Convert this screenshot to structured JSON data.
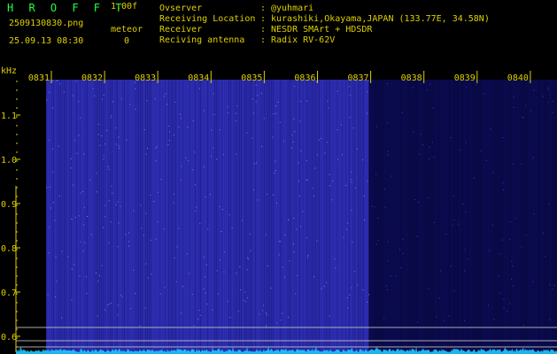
{
  "header": {
    "app_title": "H R O F F T",
    "version": "1.00f",
    "filename": "2509130830.png",
    "datetime": "25.09.13 08:30",
    "meteor_label": "meteor",
    "meteor_count": "0"
  },
  "station_info": [
    {
      "key": "Ovserver",
      "value": "@yuhmari"
    },
    {
      "key": "Receiving Location",
      "value": "kurashiki,Okayama,JAPAN (133.77E, 34.58N)"
    },
    {
      "key": "Receiver",
      "value": "NESDR SMArt + HDSDR"
    },
    {
      "key": "Reciving antenna",
      "value": "Radix RV-62V"
    }
  ],
  "y_axis": {
    "unit": "kHz",
    "ticks": [
      "1.1",
      "1.0",
      "0.9",
      "0.8",
      "0.7",
      "0.6"
    ]
  },
  "time_axis": {
    "ticks": [
      "0831",
      "0832",
      "0833",
      "0834",
      "0835",
      "0836",
      "0837",
      "0838",
      "0839",
      "0840"
    ]
  },
  "colors": {
    "background": "#000000",
    "label": "#ddd000",
    "title": "#22ff44",
    "noise_trace": "#22c8ff",
    "waterfall_dim": "#0a0a4a",
    "waterfall_bright": "#2a2aa8"
  }
}
